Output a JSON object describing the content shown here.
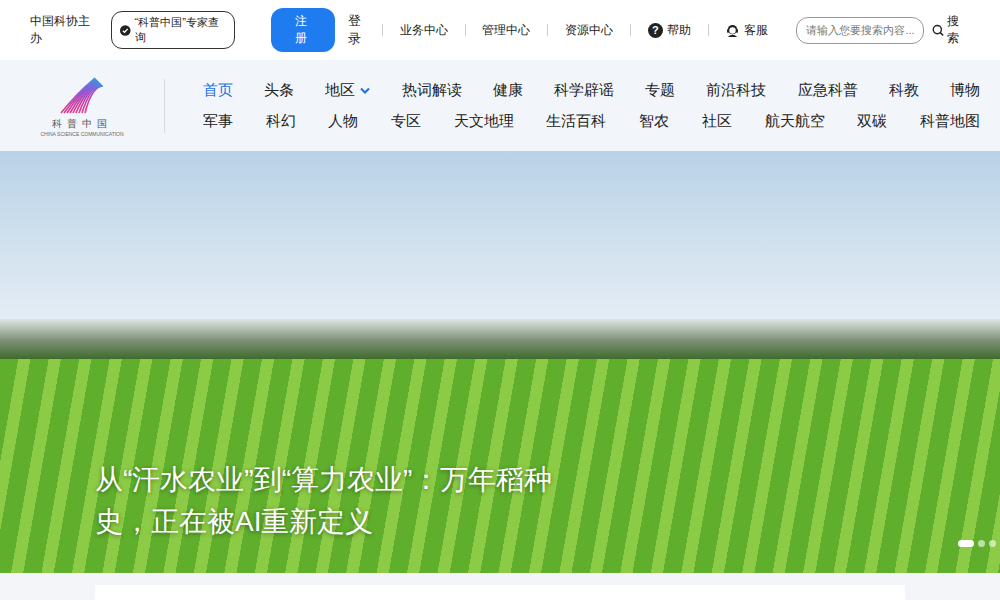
{
  "top_bar": {
    "host": "中国科协主办",
    "expert_query": "“科普中国”专家查询",
    "register": "注册",
    "login": "登录",
    "links": [
      "业务中心",
      "管理中心",
      "资源中心"
    ],
    "help_icon": "?",
    "help": "帮助",
    "service": "客服",
    "search": {
      "placeholder": "请输入您要搜索内容...",
      "button": "搜索"
    }
  },
  "logo": {
    "name": "科普中国",
    "english": "CHINA SCIENCE COMMUNICATION"
  },
  "nav": {
    "rows": [
      [
        {
          "label": "首页",
          "selected": true,
          "dropdown": false
        },
        {
          "label": "头条",
          "selected": false,
          "dropdown": false
        },
        {
          "label": "地区",
          "selected": false,
          "dropdown": true
        },
        {
          "label": "热词解读",
          "selected": false,
          "dropdown": false
        },
        {
          "label": "健康",
          "selected": false,
          "dropdown": false
        },
        {
          "label": "科学辟谣",
          "selected": false,
          "dropdown": false
        },
        {
          "label": "专题",
          "selected": false,
          "dropdown": false
        },
        {
          "label": "前沿科技",
          "selected": false,
          "dropdown": false
        },
        {
          "label": "应急科普",
          "selected": false,
          "dropdown": false
        },
        {
          "label": "科教",
          "selected": false,
          "dropdown": false
        },
        {
          "label": "博物",
          "selected": false,
          "dropdown": false
        }
      ],
      [
        {
          "label": "军事",
          "selected": false,
          "dropdown": false
        },
        {
          "label": "科幻",
          "selected": false,
          "dropdown": false
        },
        {
          "label": "人物",
          "selected": false,
          "dropdown": false
        },
        {
          "label": "专区",
          "selected": false,
          "dropdown": false
        },
        {
          "label": "天文地理",
          "selected": false,
          "dropdown": false
        },
        {
          "label": "生活百科",
          "selected": false,
          "dropdown": false
        },
        {
          "label": "智农",
          "selected": false,
          "dropdown": false
        },
        {
          "label": "社区",
          "selected": false,
          "dropdown": false
        },
        {
          "label": "航天航空",
          "selected": false,
          "dropdown": false
        },
        {
          "label": "双碳",
          "selected": false,
          "dropdown": false
        },
        {
          "label": "科普地图",
          "selected": false,
          "dropdown": false
        }
      ]
    ]
  },
  "banner": {
    "caption": "从“汗水农业”到“算力农业”：万年稻种史，正在被AI重新定义",
    "dots": [
      {
        "selected": true
      },
      {
        "selected": false
      },
      {
        "selected": false
      }
    ]
  }
}
